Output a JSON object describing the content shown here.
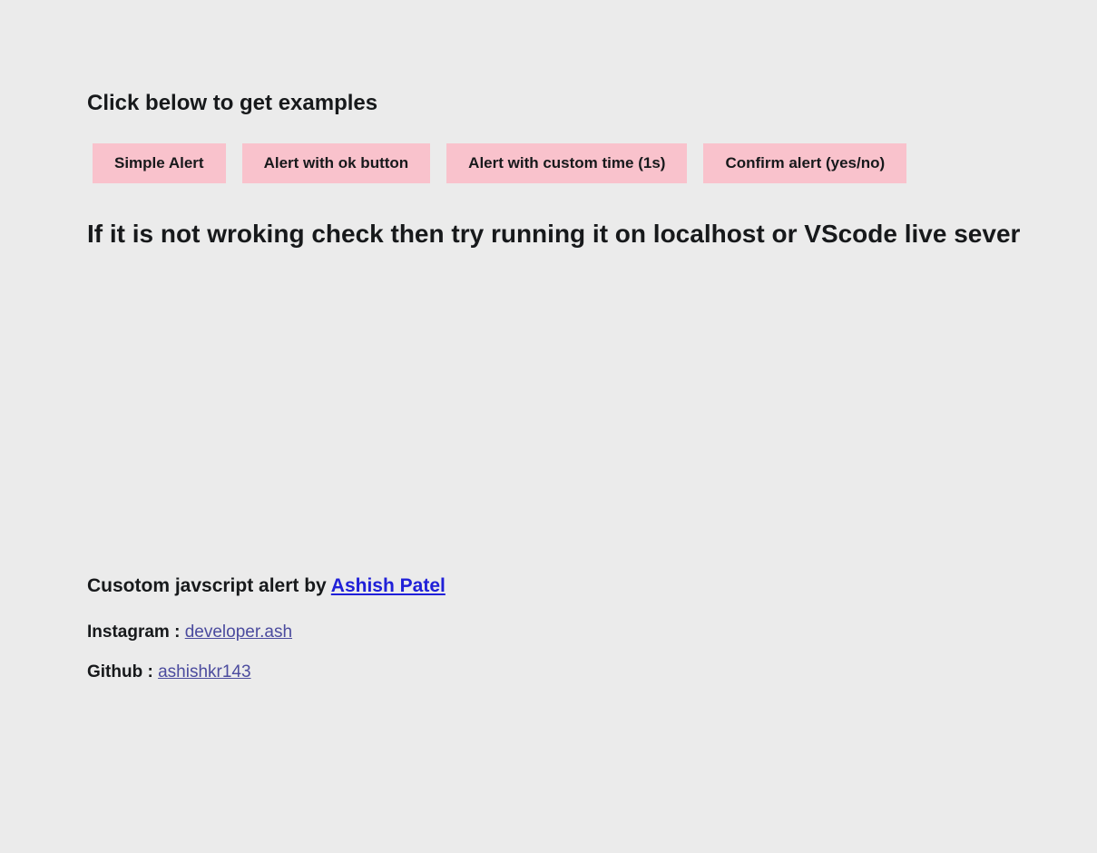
{
  "headings": {
    "title": "Click below to get examples",
    "warning": "If it is not wroking check then try running it on localhost or VScode live sever"
  },
  "buttons": [
    {
      "label": "Simple Alert"
    },
    {
      "label": "Alert with ok button"
    },
    {
      "label": "Alert with custom time (1s)"
    },
    {
      "label": "Confirm alert (yes/no)"
    }
  ],
  "credit": {
    "prefix": "Cusotom javscript alert by ",
    "author": "Ashish Patel"
  },
  "social": {
    "instagram_label": "Instagram : ",
    "instagram_handle": "developer.ash",
    "github_label": "Github : ",
    "github_handle": "ashishkr143"
  }
}
